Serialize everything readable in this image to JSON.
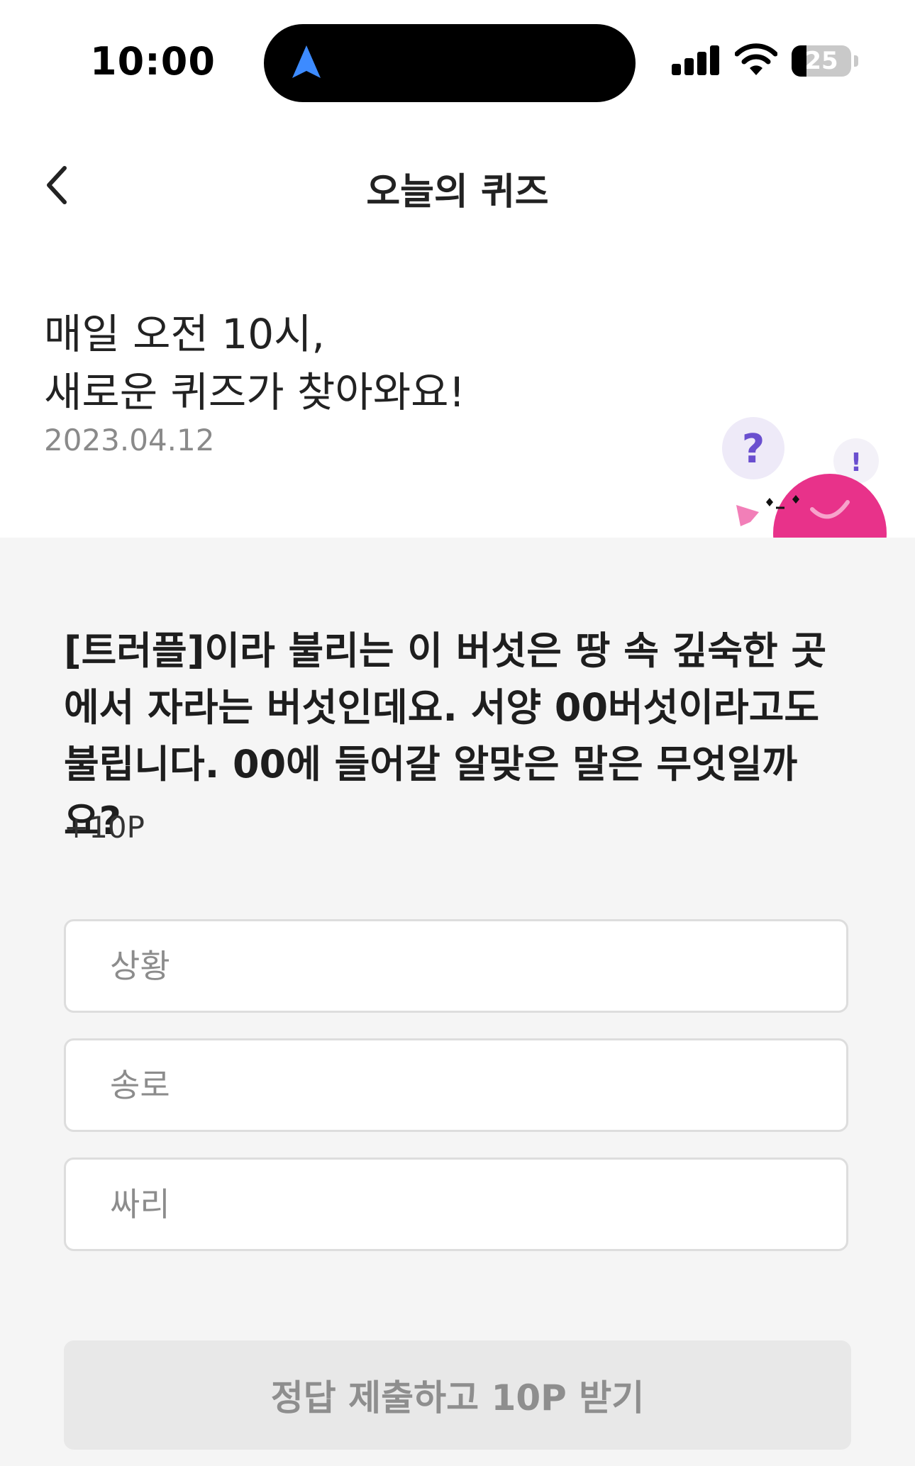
{
  "status_bar": {
    "time": "10:00",
    "battery_level": "25"
  },
  "header": {
    "title": "오늘의 퀴즈"
  },
  "intro": {
    "line1": "매일 오전 10시,",
    "line2": "새로운 퀴즈가 찾아와요!",
    "date": "2023.04.12"
  },
  "mascot": {
    "question_mark": "?",
    "exclamation_mark": "!"
  },
  "quiz": {
    "question": "[트러플]이라 불리는 이 버섯은 땅 속 깊숙한 곳에서 자라는 버섯인데요. 서양 00버섯이라고도 불립니다. 00에 들어갈 알맞은 말은 무엇일까요?",
    "points": "+10P",
    "options": [
      {
        "label": "상황"
      },
      {
        "label": "송로"
      },
      {
        "label": "싸리"
      }
    ],
    "submit_label": "정답 제출하고 10P 받기"
  },
  "colors": {
    "mascot_pink": "#e8328a",
    "question_purple": "#6a4fcf",
    "nav_blue": "#3d8bff"
  }
}
